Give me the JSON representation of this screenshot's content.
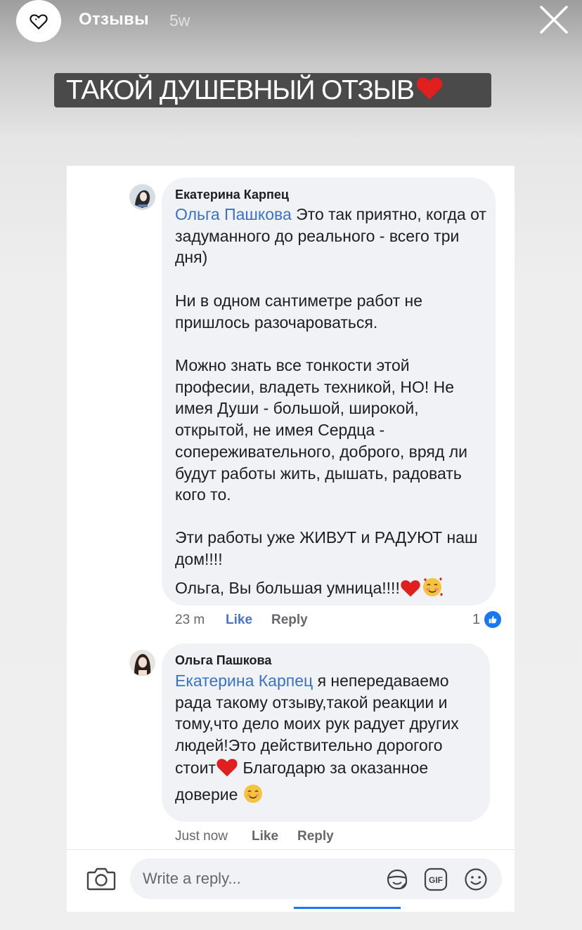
{
  "story": {
    "account_name": "Отзывы",
    "time_ago": "5w",
    "caption": "ТАКОЙ ДУШЕВНЫЙ ОТЗЫВ"
  },
  "comments": [
    {
      "author": "Екатерина Карпец",
      "mention": "Ольга Пашкова",
      "text_first": " Это так приятно, когда от задуманного до реального - всего три дня)",
      "paragraphs": [
        "Ни в одном сантиметре работ не пришлось разочароваться.",
        "Можно знать все тонкости этой професии, владеть техникой, НО! Не имея Души - большой, широкой, открытой, не имея Сердца - сопереживательного, доброго, вряд ли будут работы жить, дышать, радовать кого то.",
        "Эти работы уже ЖИВУТ и РАДУЮТ наш дом!!!!",
        "Ольга, Вы большая умница!!!!"
      ],
      "time": "23 m",
      "like_label": "Like",
      "reply_label": "Reply",
      "reaction_count": "1"
    },
    {
      "author": "Ольга Пашкова",
      "mention": "Екатерина Карпец",
      "text_first": " я непередаваемо рада такому отзыву,такой реакции и тому,что дело моих рук радует других людей!Это действительно дорогого стоит",
      "text_second": " Благодарю за оказанное доверие ",
      "time": "Just now",
      "like_label": "Like",
      "reply_label": "Reply"
    }
  ],
  "composer": {
    "placeholder": "Write a reply..."
  },
  "icons": {
    "story_avatar": "heart-icon",
    "close": "close-icon",
    "camera": "camera-icon",
    "sticker": "sticker-icon",
    "gif": "gif-icon",
    "emoji": "smiley-icon",
    "like_reaction": "thumbs-up-icon"
  },
  "colors": {
    "mention": "#3a72c6",
    "like_active": "#4a72d0",
    "reaction_blue": "#1877f2",
    "bubble_bg": "#f0f2f5"
  }
}
